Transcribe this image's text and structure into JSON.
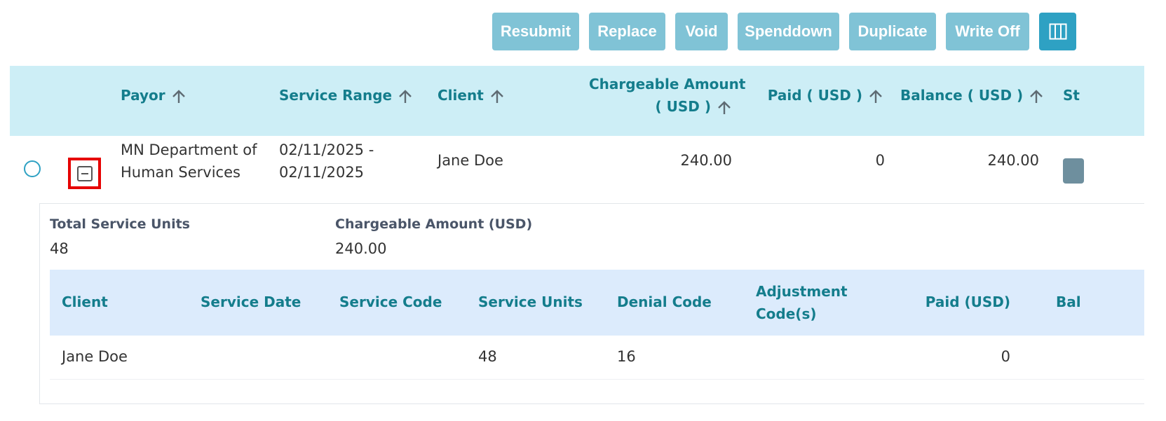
{
  "toolbar": {
    "buttons": [
      "Resubmit",
      "Replace",
      "Void",
      "Spenddown",
      "Duplicate",
      "Write Off"
    ],
    "columns_icon": "columns-icon"
  },
  "table": {
    "headers": {
      "payor": "Payor",
      "service_range": "Service Range",
      "client": "Client",
      "chargeable_line1": "Chargeable Amount",
      "chargeable_line2": "( USD )",
      "paid": "Paid ( USD )",
      "balance": "Balance ( USD )",
      "status_partial": "St"
    },
    "row": {
      "payor_line1": "MN Department of",
      "payor_line2": "Human Services",
      "range_line1": "02/11/2025 -",
      "range_line2": "02/11/2025",
      "client": "Jane Doe",
      "chargeable": "240.00",
      "paid": "0",
      "balance": "240.00"
    }
  },
  "detail": {
    "total_units_label": "Total Service Units",
    "total_units_value": "48",
    "chargeable_label": "Chargeable Amount (USD)",
    "chargeable_value": "240.00",
    "sub_headers": {
      "client": "Client",
      "service_date": "Service Date",
      "service_code": "Service Code",
      "service_units": "Service Units",
      "denial_code": "Denial Code",
      "adjustment_line1": "Adjustment",
      "adjustment_line2": "Code(s)",
      "paid": "Paid (USD)",
      "balance_partial": "Bal"
    },
    "sub_row": {
      "client": "Jane Doe",
      "service_date": "",
      "service_code": "",
      "service_units": "48",
      "denial_code": "16",
      "adjustment": "",
      "paid": "0"
    }
  },
  "colors": {
    "button_bg": "#80c3d6",
    "columns_button_bg": "#2ea1c3",
    "header_bg": "#cdeef6",
    "sub_header_bg": "#dcebfc",
    "header_text": "#147d8c",
    "highlight": "#e60000"
  }
}
